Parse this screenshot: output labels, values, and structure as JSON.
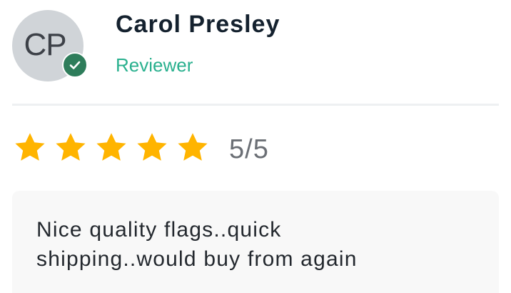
{
  "reviewer": {
    "initials": "CP",
    "name": "Carol Presley",
    "role": "Reviewer",
    "verified": true
  },
  "rating": {
    "stars": 5,
    "max": 5,
    "label": "5/5"
  },
  "review": {
    "text": "Nice quality flags..quick shipping..would buy from again"
  },
  "colors": {
    "star": "#ffb400",
    "verified_badge": "#2e7d5b",
    "role_text": "#29b08e",
    "avatar_bg": "#d0d4d8"
  },
  "icons": {
    "verified": "check-badge-icon",
    "star": "star-icon"
  }
}
